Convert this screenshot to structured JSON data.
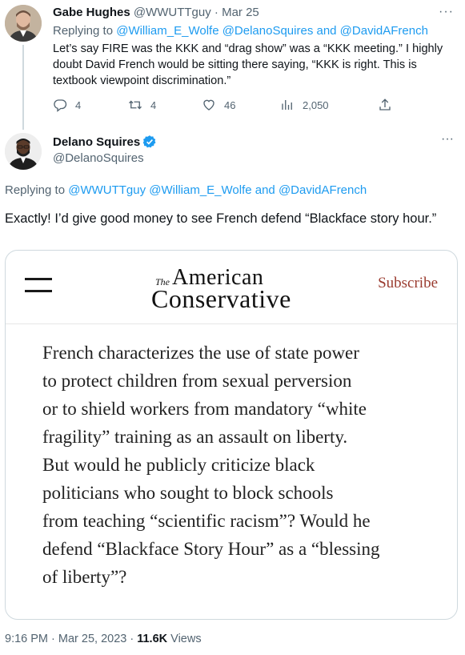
{
  "reply_tweet": {
    "author_name": "Gabe Hughes",
    "author_handle": "@WWUTTguy",
    "separator": "·",
    "date": "Mar 25",
    "more_label": "···",
    "replying_prefix": "Replying to",
    "replying_to": "@William_E_Wolfe @DelanoSquires and @DavidAFrench",
    "text": "Let’s say FIRE was the KKK and “drag show” was a “KKK meeting.” I highly doubt David French would be sitting there saying, “KKK is right. This is textbook viewpoint discrimination.”",
    "actions": {
      "replies": "4",
      "retweets": "4",
      "likes": "46",
      "views": "2,050"
    }
  },
  "main_tweet": {
    "author_name": "Delano Squires",
    "author_handle": "@DelanoSquires",
    "more_label": "···",
    "replying_prefix": "Replying to",
    "replying_to": "@WWUTTguy @William_E_Wolfe and @DavidAFrench",
    "text": "Exactly! I’d give good money to see French defend “Blackface story hour.”",
    "card": {
      "logo_the": "The",
      "logo_line1": "American",
      "logo_line2": "Conservative",
      "subscribe_label": "Subscribe",
      "lines": [
        "French characterizes the use of state power",
        "to protect children from sexual perversion",
        "or to shield workers from mandatory “white",
        "fragility” training as an assault on liberty.",
        "But would he publicly criticize black",
        "politicians who sought to block schools",
        "from teaching “scientific racism”? Would he",
        "defend “Blackface Story Hour” as a “blessing",
        "of liberty”?"
      ]
    },
    "timestamp": "9:16 PM · Mar 25, 2023 · ",
    "views_count": "11.6K",
    "views_label": " Views"
  },
  "colors": {
    "link": "#1d9bf0",
    "secondary_text": "#536471",
    "primary_text": "#0f1419",
    "subscribe": "#9a3a2e",
    "verified": "#1d9bf0"
  }
}
